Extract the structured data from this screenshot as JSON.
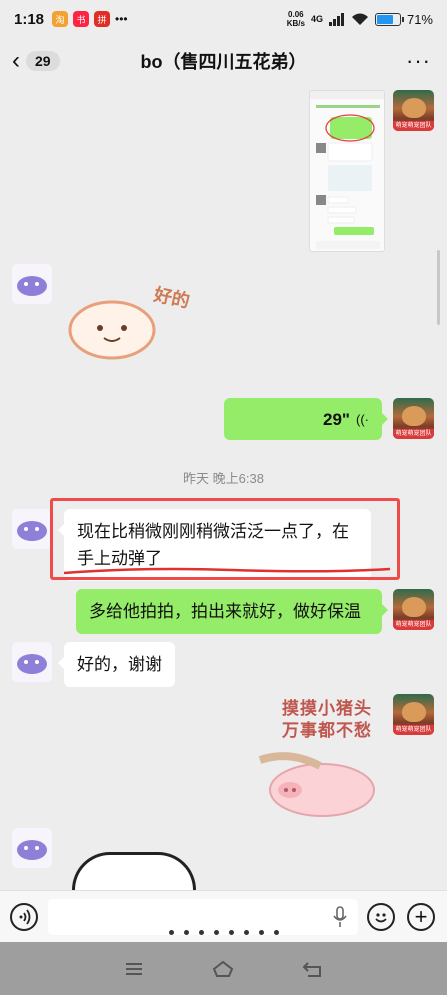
{
  "status_bar": {
    "time": "1:18",
    "network_speed_value": "0.06",
    "network_speed_unit": "KB/s",
    "network_type": "4G",
    "battery_percent": "71%",
    "battery_level": 0.71,
    "app_badges": [
      "淘",
      "小红书",
      "拼多多"
    ]
  },
  "header": {
    "back_icon": "chevron-left-icon",
    "unread_count": "29",
    "title": "bo（售四川五花弟）",
    "more_icon": "more-dots-icon"
  },
  "messages": {
    "voice_duration": "29\"",
    "timestamp": "昨天 晚上6:38",
    "msg_highlighted": "现在比稍微刚刚稍微活泛一点了，在手上动弹了",
    "msg_reply": "多给他拍拍，拍出来就好，做好保温",
    "msg_thanks": "好的，谢谢",
    "sticker_1_text": "好的",
    "sticker_2_line1": "摸摸小猪头",
    "sticker_2_line2": "万事都不愁",
    "avatar_right_label": "萌宠萌宠团队"
  },
  "input_bar": {
    "placeholder": "",
    "voice_icon": "voice-mode-icon",
    "mic_icon": "microphone-icon",
    "emoji_icon": "emoji-icon",
    "plus_icon": "plus-icon"
  },
  "nav_bar": {
    "menu_icon": "menu-icon",
    "home_icon": "home-icon",
    "back_icon": "back-icon"
  },
  "colors": {
    "accent_bubble": "#95ec69",
    "highlight_border": "#ef4b4b",
    "background": "#ededed"
  }
}
